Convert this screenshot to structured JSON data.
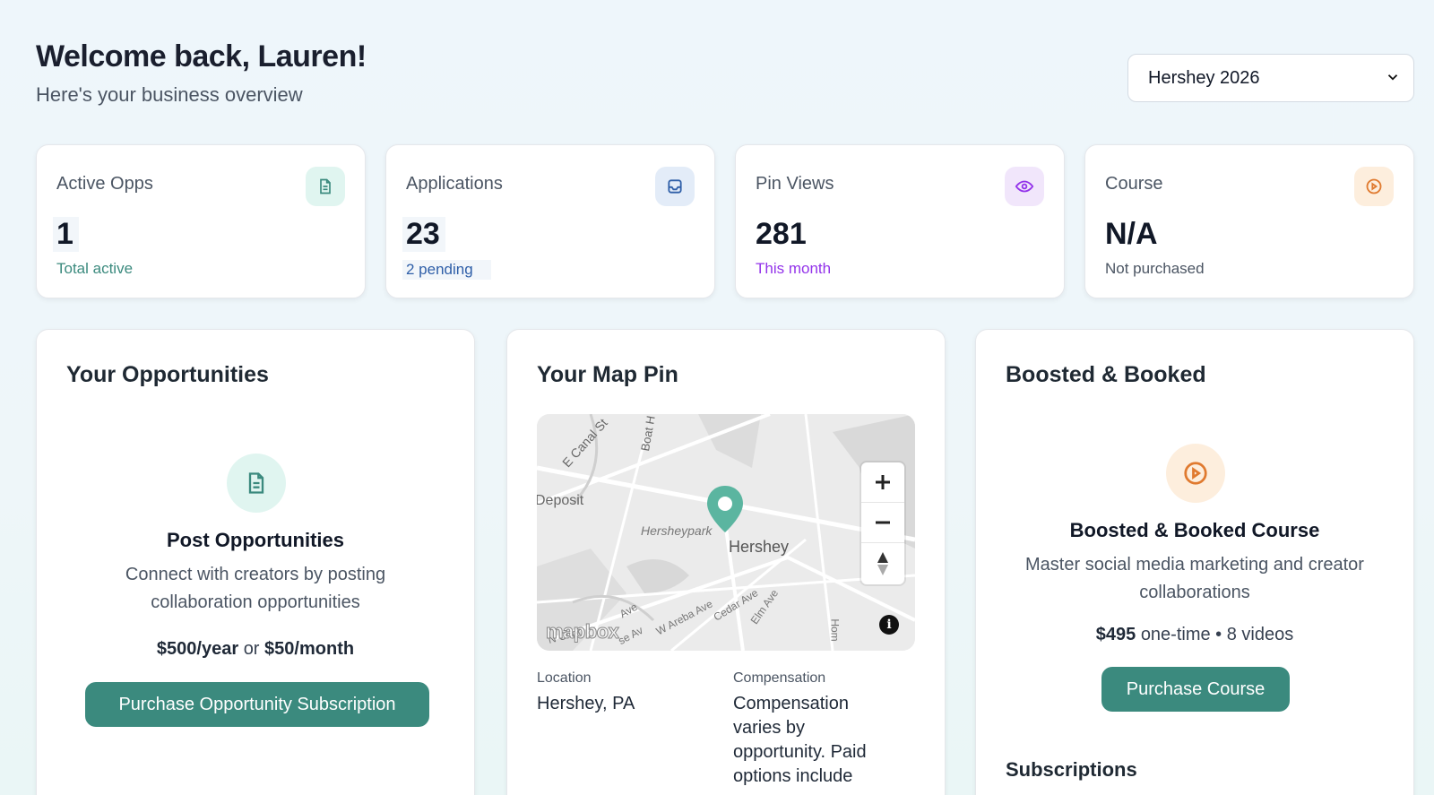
{
  "header": {
    "title": "Welcome back, Lauren!",
    "subtitle": "Here's your business overview"
  },
  "season_select": {
    "value": "Hershey 2026"
  },
  "stats": {
    "active": {
      "label": "Active Opps",
      "value": "1",
      "sub": "Total active",
      "color": "#3b8a7e",
      "bg": "#e0f5f0"
    },
    "applications": {
      "label": "Applications",
      "value": "23",
      "sub": "2 pending",
      "color": "#2f5fa8",
      "bg": "#e3ecf8"
    },
    "pins": {
      "label": "Pin Views",
      "value": "281",
      "sub": "This month",
      "color": "#9333ea",
      "bg": "#f1e6fb"
    },
    "course": {
      "label": "Course",
      "value": "N/A",
      "sub": "Not purchased",
      "color": "#e07a2f",
      "bg": "#fdeedd"
    }
  },
  "opportunities": {
    "title": "Your Opportunities",
    "heading": "Post Opportunities",
    "description_line1": "Connect with creators by posting",
    "description_line2": "collaboration opportunities",
    "price_year": "$500/year",
    "price_or": "or",
    "price_month": "$50/month",
    "button": "Purchase Opportunity Subscription"
  },
  "map_pin": {
    "title": "Your Map Pin",
    "map_labels": {
      "canal": "E Canal St",
      "boat": "Boat H",
      "deposit": "Deposit",
      "park": "Hersheypark",
      "town": "Hershey",
      "areba": "W Areba Ave",
      "cedar": "Cedar Ave",
      "elm": "Elm Ave",
      "choc": "N Choc",
      "ave1": "Ave",
      "ave2": "se Av",
      "hom": "Hom",
      "attribution": "mapbox"
    },
    "location_label": "Location",
    "location_value": "Hershey, PA",
    "compensation_label": "Compensation",
    "compensation_line1": "Compensation",
    "compensation_line2": "varies by",
    "compensation_line3": "opportunity. Paid",
    "compensation_line4": "options include"
  },
  "boosted": {
    "title": "Boosted & Booked",
    "heading": "Boosted & Booked Course",
    "description_line1": "Master social media marketing and creator",
    "description_line2": "collaborations",
    "price": "$495",
    "price_detail": "one-time • 8 videos",
    "button": "Purchase Course",
    "subscriptions_title": "Subscriptions"
  },
  "icons": {
    "active": "document-icon",
    "applications": "inbox-icon",
    "pins": "eye-icon",
    "course": "play-circle-icon",
    "map_pin": "map-marker-icon",
    "zoom_in": "plus-icon",
    "zoom_out": "minus-icon",
    "compass": "compass-icon",
    "info": "info-icon"
  }
}
